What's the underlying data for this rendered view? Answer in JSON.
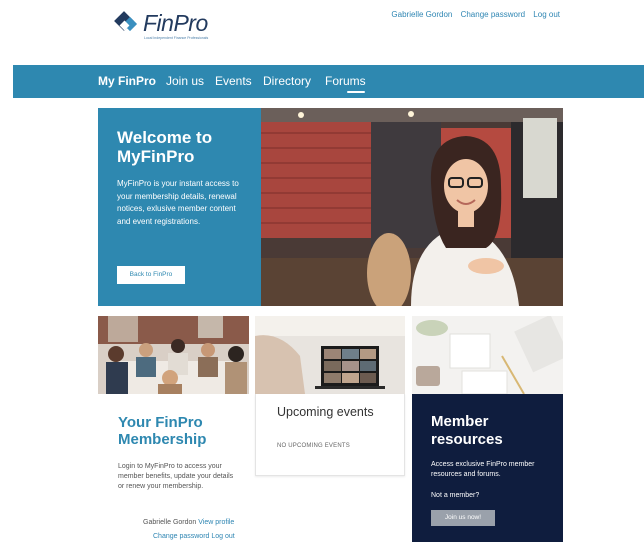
{
  "brand": {
    "name": "FinPro",
    "tagline": "Local Independent Finance Professionals"
  },
  "user_links": {
    "name": "Gabrielle Gordon",
    "change_password": "Change password",
    "logout": "Log out"
  },
  "nav": {
    "items": [
      {
        "label": "My FinPro",
        "active": true
      },
      {
        "label": "Join us"
      },
      {
        "label": "Events"
      },
      {
        "label": "Directory"
      },
      {
        "label": "Forums"
      }
    ]
  },
  "hero": {
    "title": "Welcome to MyFinPro",
    "text": "MyFinPro is your instant access to your membership details, renewal notices, exlusive member content and event registrations.",
    "button": "Back to FinPro"
  },
  "membership": {
    "title": "Your FinPro Membership",
    "text": "Login to MyFinPro to access your member benefits, update your details or renew your membership.",
    "user_name": "Gabrielle Gordon",
    "view_profile": "View profile",
    "change_password": "Change password",
    "logout": "Log out"
  },
  "events": {
    "title": "Upcoming events",
    "empty": "NO UPCOMING EVENTS"
  },
  "resources": {
    "title": "Member resources",
    "text": "Access exclusive FinPro member resources and forums.",
    "question": "Not a member?",
    "button": "Join us now!"
  },
  "colors": {
    "primary": "#2e88b0",
    "navy": "#0f1d3e",
    "link": "#2f86b3"
  }
}
